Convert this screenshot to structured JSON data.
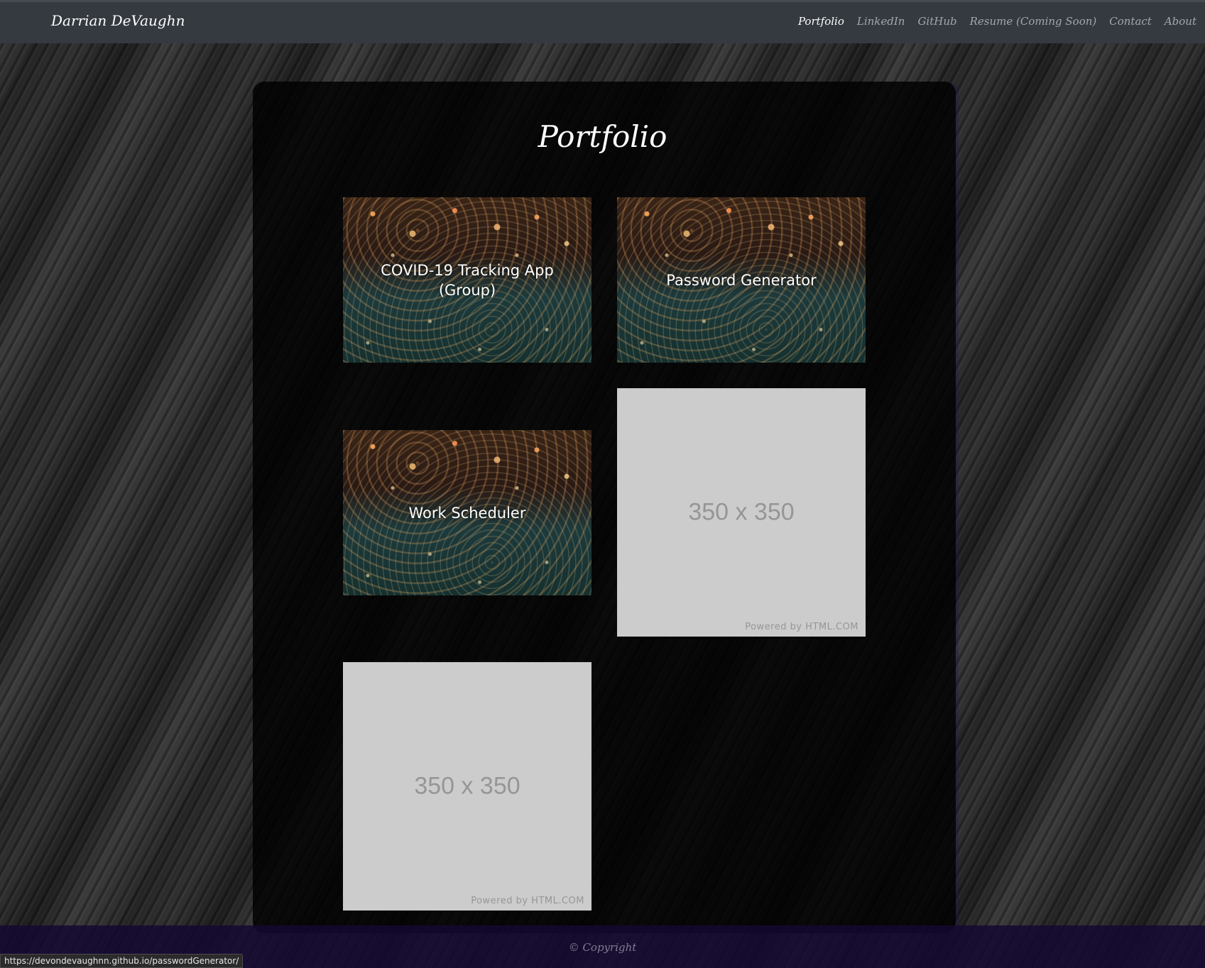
{
  "header": {
    "brand": "Darrian DeVaughn",
    "nav": [
      {
        "label": "Portfolio",
        "active": true
      },
      {
        "label": "LinkedIn",
        "active": false
      },
      {
        "label": "GitHub",
        "active": false
      },
      {
        "label": "Resume (Coming Soon)",
        "active": false
      },
      {
        "label": "Contact",
        "active": false
      },
      {
        "label": "About",
        "active": false
      }
    ]
  },
  "main": {
    "title": "Portfolio",
    "projects": [
      {
        "label": "COVID-19 Tracking App (Group)"
      },
      {
        "label": "Password Generator"
      },
      {
        "label": "Work Scheduler"
      }
    ],
    "placeholders": [
      {
        "size_text": "350 x 350",
        "powered_text": "Powered by HTML.COM"
      },
      {
        "size_text": "350 x 350",
        "powered_text": "Powered by HTML.COM"
      }
    ]
  },
  "footer": {
    "copyright": "© Copyright"
  },
  "status_bar": {
    "url": "https://devondevaughnn.github.io/passwordGenerator/"
  },
  "colors": {
    "navbar": "#343a40",
    "panel": "#000000",
    "footer": "#140832",
    "placeholder": "#cccccc"
  }
}
